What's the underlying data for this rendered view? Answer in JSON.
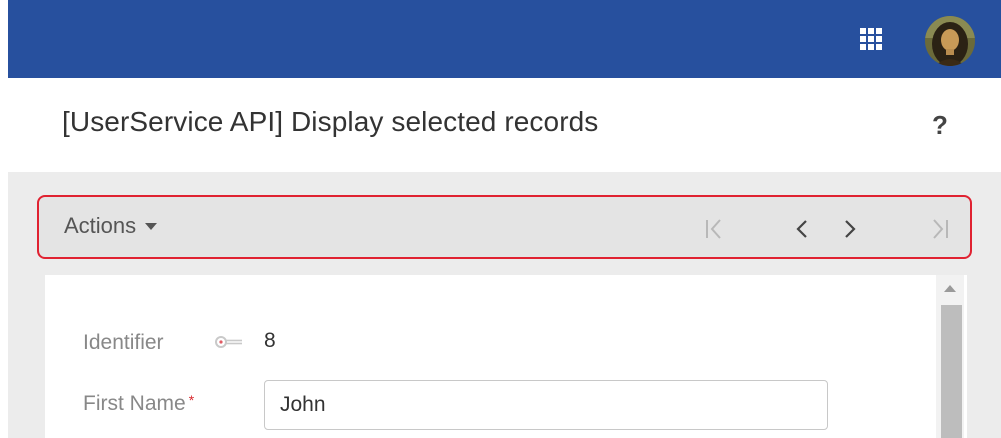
{
  "header": {
    "apps_icon": "grid-apps-icon",
    "avatar_icon": "user-avatar"
  },
  "page": {
    "title": "[UserService API] Display selected records",
    "help_label": "?"
  },
  "toolbar": {
    "actions_label": "Actions",
    "nav_icons": [
      "first-record-icon",
      "previous-record-icon",
      "next-record-icon",
      "last-record-icon"
    ]
  },
  "form": {
    "identifier": {
      "label": "Identifier",
      "value": "8",
      "icon": "key-icon"
    },
    "first_name": {
      "label": "First Name",
      "required_mark": "*",
      "value": "John"
    }
  },
  "colors": {
    "header_bg": "#27509e",
    "highlight_border": "#e02231",
    "content_bg": "#ececec",
    "toolbar_bg": "#e4e4e4"
  }
}
